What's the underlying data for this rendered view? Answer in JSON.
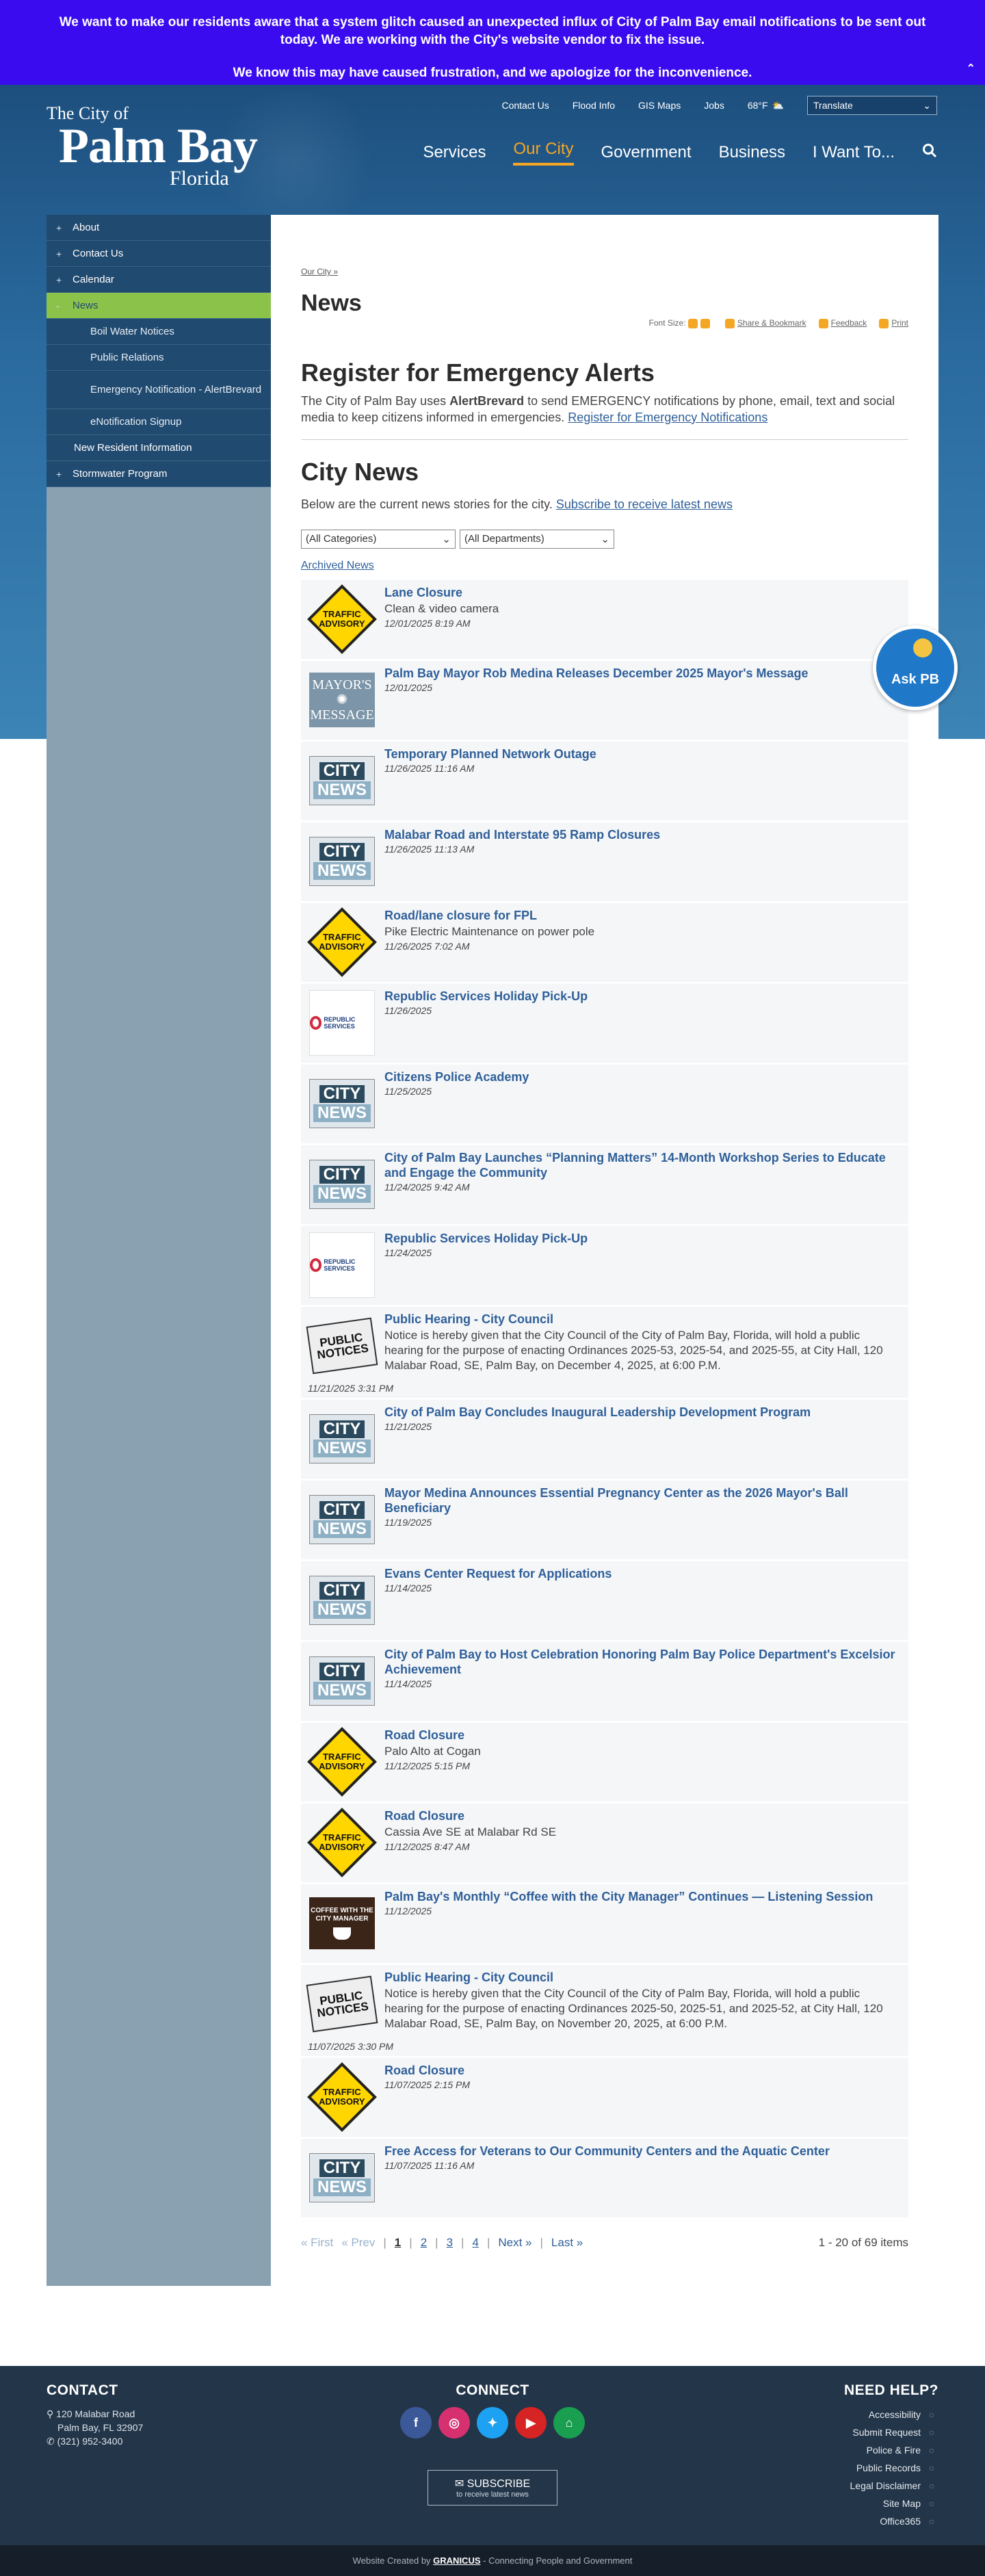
{
  "alert": {
    "line1": "We want to make our residents aware that a system glitch caused an unexpected influx of City of Palm Bay email notifications to be sent out today.  We are working with the City's website vendor to fix the issue.",
    "line2": "We know this may have caused frustration, and we apologize for the inconvenience.",
    "collapse_icon": "double-chevron-up"
  },
  "logo": {
    "l1": "The City of",
    "l2": "Palm Bay",
    "l3": "Florida"
  },
  "utility_nav": [
    "Contact Us",
    "Flood Info",
    "GIS Maps",
    "Jobs"
  ],
  "weather": {
    "temp": "68°F",
    "icon": "partly-cloudy"
  },
  "translate": {
    "label": "Translate"
  },
  "main_nav": [
    {
      "label": "Services",
      "active": false
    },
    {
      "label": "Our City",
      "active": true
    },
    {
      "label": "Government",
      "active": false
    },
    {
      "label": "Business",
      "active": false
    },
    {
      "label": "I Want To...",
      "active": false
    }
  ],
  "sidebar": {
    "items": [
      {
        "label": "About",
        "pm": "+"
      },
      {
        "label": "Contact Us",
        "pm": "+"
      },
      {
        "label": "Calendar",
        "pm": "+"
      },
      {
        "label": "News",
        "pm": "-"
      },
      {
        "label": "Boil Water Notices"
      },
      {
        "label": "Public Relations"
      },
      {
        "label": "Emergency Notification - AlertBrevard"
      },
      {
        "label": "eNotification Signup"
      },
      {
        "label": "New Resident Information"
      },
      {
        "label": "Stormwater Program",
        "pm": "+"
      }
    ]
  },
  "breadcrumb": {
    "link": "Our City",
    "sep": "»"
  },
  "page_title": "News",
  "tools": {
    "font_size": "Font Size:",
    "share": "Share & Bookmark",
    "feedback": "Feedback",
    "print": "Print"
  },
  "register": {
    "title": "Register for Emergency Alerts",
    "text_pre": "The City of Palm Bay uses ",
    "text_bold": "AlertBrevard",
    "text_post": " to send EMERGENCY notifications by phone, email, text and social media to keep citizens informed in emergencies. ",
    "link": "Register for Emergency Notifications"
  },
  "city_news": {
    "title": "City News",
    "intro": "Below are the current news stories for the city. ",
    "subscribe_link": "Subscribe to receive latest news",
    "filter_categories": "(All Categories)",
    "filter_departments": "(All Departments)",
    "archived": "Archived News"
  },
  "news": [
    {
      "thumb": "traffic",
      "title": "Lane Closure",
      "desc": "Clean & video camera",
      "date": "12/01/2025 8:19 AM"
    },
    {
      "thumb": "mayor",
      "title": "Palm Bay Mayor Rob Medina Releases December 2025 Mayor's Message",
      "desc": "",
      "date": "12/01/2025"
    },
    {
      "thumb": "city",
      "title": "Temporary Planned Network Outage",
      "desc": "",
      "date": "11/26/2025 11:16 AM"
    },
    {
      "thumb": "city",
      "title": "Malabar Road and Interstate 95 Ramp Closures",
      "desc": "",
      "date": "11/26/2025 11:13 AM"
    },
    {
      "thumb": "traffic",
      "title": "Road/lane closure for FPL",
      "desc": "Pike Electric Maintenance on power pole",
      "date": "11/26/2025 7:02 AM"
    },
    {
      "thumb": "republic",
      "title": "Republic Services Holiday Pick-Up",
      "desc": "",
      "date": "11/26/2025"
    },
    {
      "thumb": "city",
      "title": "Citizens Police Academy",
      "desc": "",
      "date": "11/25/2025"
    },
    {
      "thumb": "city",
      "title": "City of Palm Bay Launches “Planning Matters” 14-Month Workshop Series to Educate and Engage the Community",
      "desc": "",
      "date": "11/24/2025 9:42 AM"
    },
    {
      "thumb": "republic",
      "title": "Republic Services Holiday Pick-Up",
      "desc": "",
      "date": "11/24/2025"
    },
    {
      "thumb": "public",
      "title": "Public Hearing - City Council",
      "desc": "Notice is hereby given that the City Council of the City of Palm Bay, Florida, will hold a public hearing for the purpose of enacting Ordinances 2025-53, 2025-54, and 2025-55, at City Hall, 120 Malabar Road, SE, Palm Bay, on December 4, 2025, at 6:00 P.M.",
      "date": "11/21/2025 3:31 PM",
      "wide": true
    },
    {
      "thumb": "city",
      "title": "City of Palm Bay Concludes Inaugural Leadership Development Program",
      "desc": "",
      "date": "11/21/2025"
    },
    {
      "thumb": "city",
      "title": "Mayor Medina Announces Essential Pregnancy Center as the 2026 Mayor's Ball Beneficiary",
      "desc": "",
      "date": "11/19/2025"
    },
    {
      "thumb": "city",
      "title": "Evans Center Request for Applications",
      "desc": "",
      "date": "11/14/2025"
    },
    {
      "thumb": "city",
      "title": "City of Palm Bay to Host Celebration Honoring Palm Bay Police Department's Excelsior Achievement",
      "desc": "",
      "date": "11/14/2025"
    },
    {
      "thumb": "traffic",
      "title": "Road Closure",
      "desc": "Palo Alto at Cogan",
      "date": "11/12/2025 5:15 PM"
    },
    {
      "thumb": "traffic",
      "title": "Road Closure",
      "desc": "Cassia Ave SE at Malabar Rd SE",
      "date": "11/12/2025 8:47 AM"
    },
    {
      "thumb": "coffee",
      "title": "Palm Bay's Monthly “Coffee with the City Manager” Continues — Listening Session",
      "desc": "",
      "date": "11/12/2025"
    },
    {
      "thumb": "public",
      "title": "Public Hearing - City Council",
      "desc": "Notice is hereby given that the City Council of the City of Palm Bay, Florida, will hold a public hearing for the purpose of enacting Ordinances 2025-50, 2025-51, and 2025-52, at City Hall, 120 Malabar Road, SE, Palm Bay, on November 20, 2025, at 6:00 P.M.",
      "date": "11/07/2025 3:30 PM",
      "wide": true
    },
    {
      "thumb": "traffic",
      "title": "Road Closure",
      "desc": "",
      "date": "11/07/2025 2:15 PM"
    },
    {
      "thumb": "city",
      "title": "Free Access for Veterans to Our Community Centers and the Aquatic Center",
      "desc": "",
      "date": "11/07/2025 11:16 AM"
    }
  ],
  "thumb_text": {
    "traffic": "TRAFFIC ADVISORY",
    "city1": "CITY",
    "city2": "NEWS",
    "mayor1": "MAYOR'S",
    "mayor2": "MESSAGE",
    "republic": "REPUBLIC SERVICES",
    "public": "PUBLIC NOTICES",
    "coffee": "COFFEE WITH THE CITY MANAGER"
  },
  "pager": {
    "first": "« First",
    "prev": "« Prev",
    "pages": [
      "1",
      "2",
      "3",
      "4"
    ],
    "current": "1",
    "next": "Next »",
    "last": "Last »",
    "count": "1 - 20 of 69 items"
  },
  "askpb": {
    "label": "Ask PB"
  },
  "footer": {
    "contact_title": "CONTACT",
    "address1": "120 Malabar Road",
    "address2": "Palm Bay, FL 32907",
    "phone": "(321) 952-3400",
    "connect_title": "CONNECT",
    "socials": [
      {
        "name": "facebook",
        "glyph": "f",
        "color": "#3b5998"
      },
      {
        "name": "instagram",
        "glyph": "◎",
        "color": "#d6306f"
      },
      {
        "name": "twitter",
        "glyph": "✦",
        "color": "#1da1f2"
      },
      {
        "name": "youtube",
        "glyph": "▶",
        "color": "#d62424"
      },
      {
        "name": "nextdoor",
        "glyph": "⌂",
        "color": "#1a9e50"
      }
    ],
    "subscribe": "SUBSCRIBE",
    "subscribe_sub": "to receive latest news",
    "help_title": "NEED HELP?",
    "help_links": [
      "Accessibility",
      "Submit Request",
      "Police & Fire",
      "Public Records",
      "Legal Disclaimer",
      "Site Map",
      "Office365"
    ]
  },
  "credit": {
    "pre": "Website Created by ",
    "brand": "GRANICUS",
    "post": " - Connecting People and Government"
  }
}
